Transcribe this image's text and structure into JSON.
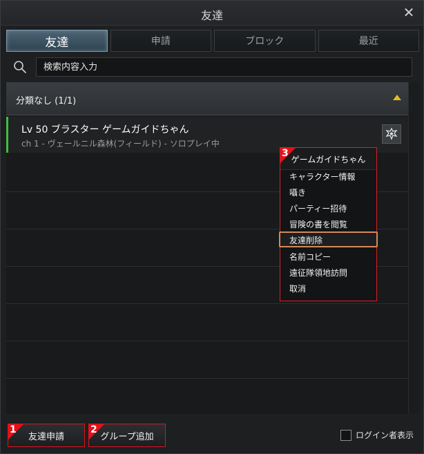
{
  "window": {
    "title": "友達"
  },
  "tabs": [
    {
      "label": "友達",
      "active": true
    },
    {
      "label": "申請",
      "active": false
    },
    {
      "label": "ブロック",
      "active": false
    },
    {
      "label": "最近",
      "active": false
    }
  ],
  "search": {
    "placeholder": "検索内容入力",
    "icon": "search-icon"
  },
  "group": {
    "label": "分類なし (1/1)",
    "toggle_icon": "chevron-up-icon"
  },
  "friend": {
    "name": "Lv 50  ブラスター  ゲームガイドちゃん",
    "location": "ch 1 - ヴェールニル森林(フィールド) - ソロプレイ中",
    "class_icon": "class-emblem-icon",
    "status_color": "#3fbf3f"
  },
  "context_menu": {
    "badge": "3",
    "title": "ゲームガイドちゃん",
    "items": [
      {
        "label": "キャラクター情報",
        "highlighted": false
      },
      {
        "label": "囁き",
        "highlighted": false
      },
      {
        "label": "パーティー招待",
        "highlighted": false
      },
      {
        "label": "冒険の書を閲覧",
        "highlighted": false
      },
      {
        "label": "友達削除",
        "highlighted": true
      },
      {
        "label": "名前コピー",
        "highlighted": false
      },
      {
        "label": "遠征隊領地訪問",
        "highlighted": false
      },
      {
        "label": "取消",
        "highlighted": false
      }
    ]
  },
  "footer": {
    "add_friend": {
      "label": "友達申請",
      "badge": "1"
    },
    "add_group": {
      "label": "グループ追加",
      "badge": "2"
    },
    "show_online": {
      "label": "ログイン者表示",
      "checked": false
    }
  },
  "colors": {
    "accent_tab": "#4d6474",
    "annotation_red": "#e0121b",
    "toggle_gold": "#e6b822"
  }
}
